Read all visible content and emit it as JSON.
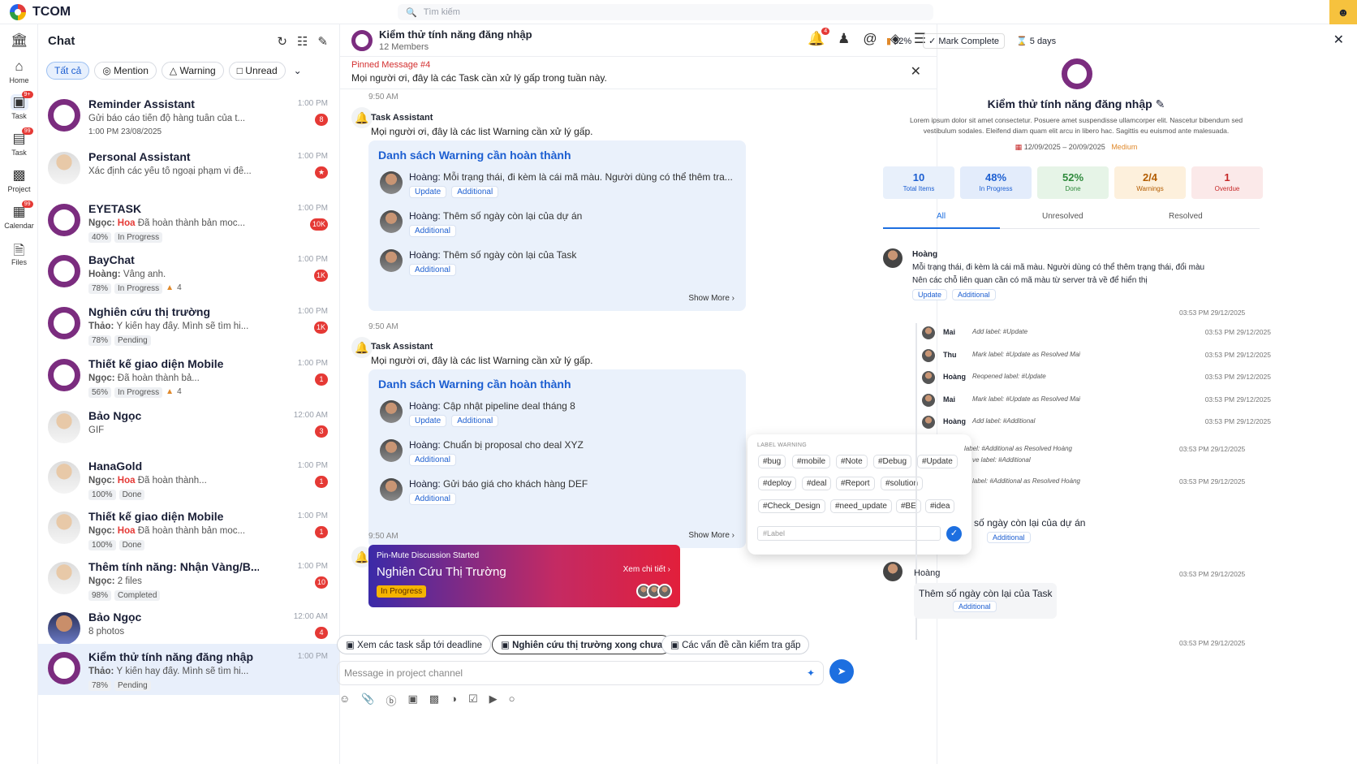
{
  "app": {
    "name": "TCOM",
    "search_placeholder": "Tìm kiếm"
  },
  "rail": [
    {
      "label": "",
      "icon": "building-icon"
    },
    {
      "label": "Home",
      "icon": "home-icon"
    },
    {
      "label": "Task",
      "icon": "task-icon",
      "badge": "9+"
    },
    {
      "label": "Task",
      "icon": "task-icon",
      "badge": "99"
    },
    {
      "label": "Project",
      "icon": "project-icon"
    },
    {
      "label": "Calendar",
      "icon": "calendar-icon",
      "badge": "99"
    },
    {
      "label": "Files",
      "icon": "files-icon"
    }
  ],
  "chat": {
    "title": "Chat",
    "filters": [
      "Tất cả",
      "Mention",
      "Warning",
      "Unread"
    ],
    "conversations": [
      {
        "name": "Reminder Assistant",
        "msg": "Gửi báo cáo tiến độ hàng tuần của t...",
        "meta": "1:00 PM 23/08/2025",
        "time": "1:00 PM",
        "count": "8",
        "av": "logo"
      },
      {
        "name": "Personal Assistant",
        "msg": "Xác định các yếu tố ngoại phạm vi để...",
        "time": "1:00 PM",
        "count": "★",
        "av": "person"
      },
      {
        "name": "EYETASK",
        "sender": "Ngọc:",
        "hl": "Hoa",
        "msg": "Đã hoàn thành bản moc...",
        "progress": "40%",
        "status": "In Progress",
        "time": "1:00 PM",
        "count": "10K",
        "av": "logo"
      },
      {
        "name": "BayChat",
        "sender": "Hoàng:",
        "msg": "Vâng anh.",
        "progress": "78%",
        "status": "In Progress",
        "warn": "4",
        "time": "1:00 PM",
        "count": "1K",
        "av": "logo"
      },
      {
        "name": "Nghiên cứu thị trường",
        "sender": "Thảo:",
        "msg": "Ý kiến hay đấy. Mình sẽ tìm hi...",
        "progress": "78%",
        "status": "Pending",
        "time": "1:00 PM",
        "count": "1K",
        "av": "logo"
      },
      {
        "name": "Thiết kế giao diện Mobile",
        "sender": "Ngọc:",
        "msg": "Đã hoàn thành bả...",
        "progress": "56%",
        "status": "In Progress",
        "warn": "4",
        "time": "1:00 PM",
        "count": "1",
        "av": "logo"
      },
      {
        "name": "Bảo Ngọc",
        "msg": "GIF",
        "time": "12:00 AM",
        "count": "3",
        "av": "person"
      },
      {
        "name": "HanaGold",
        "sender": "Ngọc:",
        "hl": "Hoa",
        "msg": "Đã hoàn thành...",
        "progress": "100%",
        "status": "Done",
        "time": "1:00 PM",
        "count": "1",
        "av": "person"
      },
      {
        "name": "Thiết kế giao diện Mobile",
        "sender": "Ngọc:",
        "hl": "Hoa",
        "msg": "Đã hoàn thành bản moc...",
        "progress": "100%",
        "status": "Done",
        "time": "1:00 PM",
        "count": "1",
        "av": "person"
      },
      {
        "name": "Thêm tính năng: Nhận Vàng/B...",
        "sender": "Ngọc:",
        "msg": "2 files",
        "progress": "98%",
        "status": "Completed",
        "time": "1:00 PM",
        "count": "10",
        "av": "person"
      },
      {
        "name": "Bảo Ngọc",
        "msg": "8 photos",
        "time": "12:00 AM",
        "count": "4",
        "av": "photo"
      },
      {
        "name": "Kiểm thử tính năng đăng nhập",
        "sender": "Thảo:",
        "msg": "Ý kiến hay đấy. Mình sẽ tìm hi...",
        "progress": "78%",
        "status": "Pending",
        "time": "1:00 PM",
        "av": "logo",
        "selected": true
      }
    ]
  },
  "channel": {
    "title": "Kiểm thử tính năng đăng nhập",
    "members": "12 Members",
    "notif_badge": "4",
    "pinned_label": "Pinned Message #4",
    "pinned_text": "Mọi người ơi, đây là các Task cần xử lý gấp trong tuần này.",
    "messages": [
      {
        "time": "9:50 AM",
        "sender": "Task Assistant",
        "text": "Mọi người ơi, đây là các list Warning cần xử lý gấp.",
        "card_title": "Danh sách Warning cần hoàn thành",
        "items": [
          {
            "who": "Hoàng:",
            "text": "Mỗi trạng thái, đi kèm là cái mã màu. Người dùng có thể thêm tra...",
            "labels": [
              "Update",
              "Additional"
            ]
          },
          {
            "who": "Hoàng:",
            "text": "Thêm số ngày còn lại của dự án",
            "labels": [
              "Additional"
            ]
          },
          {
            "who": "Hoàng:",
            "text": "Thêm số ngày còn lại của Task",
            "labels": [
              "Additional"
            ]
          }
        ],
        "show_more": "Show More"
      },
      {
        "time": "9:50 AM",
        "sender": "Task Assistant",
        "text": "Mọi người ơi, đây là các list Warning cần xử lý gấp.",
        "card_title": "Danh sách Warning cần hoàn thành",
        "items": [
          {
            "who": "Hoàng:",
            "text": "Cập nhật pipeline deal tháng 8",
            "labels": [
              "Update",
              "Additional"
            ]
          },
          {
            "who": "Hoàng:",
            "text": "Chuẩn bị proposal cho deal XYZ",
            "labels": [
              "Additional"
            ]
          },
          {
            "who": "Hoàng:",
            "text": "Gửi báo giá cho khách hàng DEF",
            "labels": [
              "Additional"
            ]
          }
        ],
        "show_more": "Show More"
      }
    ],
    "discussion": {
      "time": "9:50 AM",
      "subtitle": "Pin-Mute Discussion Started",
      "title": "Nghiên Cứu Thị Trường",
      "status": "In Progress",
      "link": "Xem chi tiết"
    },
    "suggestions": [
      "Xem các task sắp tới deadline",
      "Nghiên cứu thị trường xong chưa",
      "Các vấn đề cần kiểm tra gấp"
    ],
    "composer_placeholder": "Message in project channel"
  },
  "label_popup": {
    "title": "LABEL WARNING",
    "tags": [
      "#bug",
      "#mobile",
      "#Note",
      "#Debug",
      "#Update",
      "#deploy",
      "#deal",
      "#Report",
      "#solution",
      "#Check_Design",
      "#need_update",
      "#BE",
      "#idea"
    ],
    "input_placeholder": "#Label"
  },
  "detail": {
    "progress": "52%",
    "mark": "Mark Complete",
    "days": "5 days",
    "title": "Kiểm thử tính năng đăng nhập",
    "desc": "Lorem ipsum dolor sit amet consectetur. Posuere amet suspendisse ullamcorper elit. Nascetur bibendum sed vestibulum sodales. Eleifend diam quam elit arcu in libero hac. Sagittis eu euismod ante malesuada.",
    "dates": "12/09/2025 – 20/09/2025",
    "priority": "Medium",
    "stats": [
      {
        "v": "10",
        "l": "Total Items",
        "bg": "#e8f0fb",
        "c": "#1d5fd1"
      },
      {
        "v": "48%",
        "l": "In Progress",
        "bg": "#e3ecfb",
        "c": "#1d5fd1"
      },
      {
        "v": "52%",
        "l": "Done",
        "bg": "#e6f4e7",
        "c": "#2f8a3c"
      },
      {
        "v": "2/4",
        "l": "Warnings",
        "bg": "#fdf0dc",
        "c": "#b35c00"
      },
      {
        "v": "1",
        "l": "Overdue",
        "bg": "#fbe9e9",
        "c": "#c62828"
      }
    ],
    "tabs": [
      "All",
      "Unresolved",
      "Resolved"
    ],
    "comment1": {
      "name": "Hoàng",
      "text1": "Mỗi trạng thái, đi kèm là cái mã màu. Người dùng có thể thêm trạng thái, đổi màu",
      "text2": "Nên các chỗ liên quan cần có mã màu từ server trả về để hiển thị",
      "labels": [
        "Update",
        "Additional"
      ],
      "time": "03:53 PM 29/12/2025"
    },
    "activity": [
      {
        "name": "Mai",
        "text": "Add label: #Update",
        "time": "03:53 PM 29/12/2025"
      },
      {
        "name": "Thu",
        "text": "Mark label: #Update as Resolved Mai",
        "time": "03:53 PM 29/12/2025"
      },
      {
        "name": "Hoàng",
        "text": "Reopened label: #Update",
        "time": "03:53 PM 29/12/2025"
      },
      {
        "name": "Mai",
        "text": "Mark label: #Update as Resolved Mai",
        "time": "03:53 PM 29/12/2025"
      },
      {
        "name": "Hoàng",
        "text": "Add label: #Additional",
        "time": "03:53 PM 29/12/2025"
      }
    ],
    "hidden_rows": [
      {
        "text": "label: #Additional as Resolved Hoàng",
        "time": "03:53 PM 29/12/2025"
      },
      {
        "text": "ve label: #Additional",
        "time": ""
      },
      {
        "text": "label: #Additional as Resolved Hoàng",
        "time": "03:53 PM 29/12/2025"
      }
    ],
    "partial": {
      "text": "số ngày còn lại của dự án",
      "label": "Additional"
    },
    "comment2": {
      "name": "Hoàng",
      "text": "Thêm số ngày còn lại của Task",
      "label": "Additional",
      "time": "03:53 PM 29/12/2025"
    },
    "last_time": "03:53 PM 29/12/2025"
  }
}
